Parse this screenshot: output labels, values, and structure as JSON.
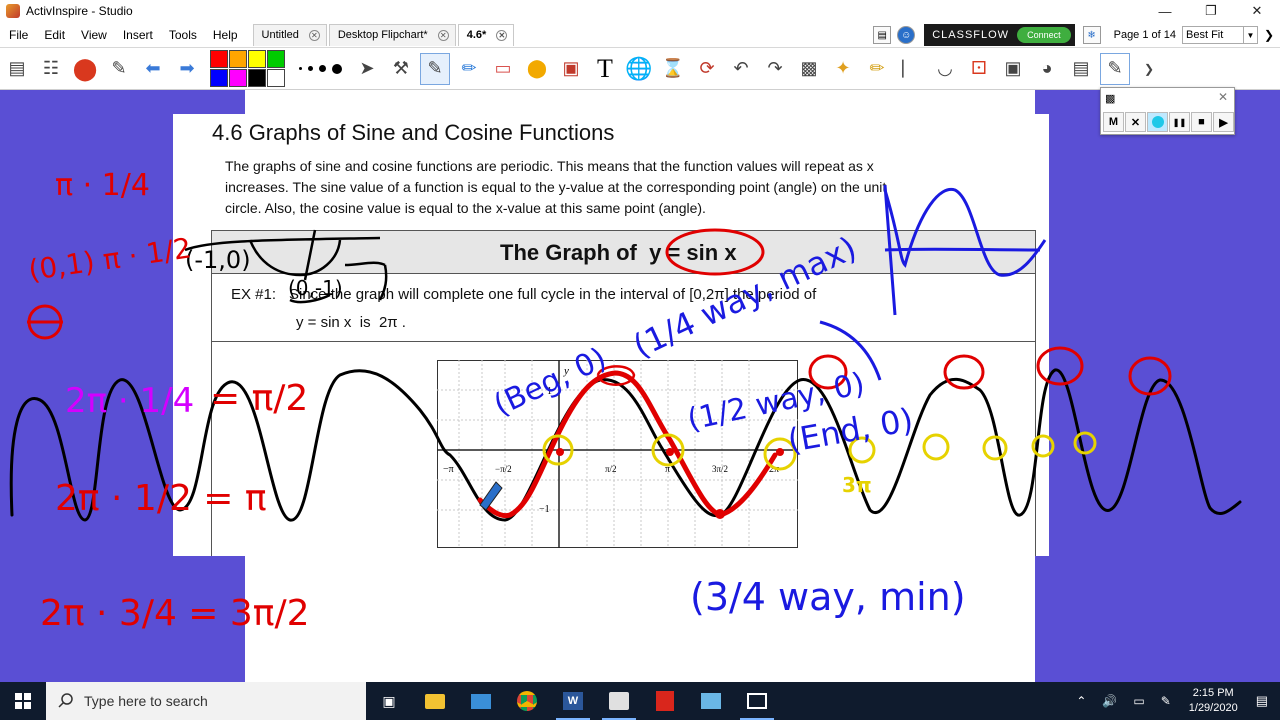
{
  "window": {
    "title": "ActivInspire - Studio"
  },
  "menu": {
    "items": [
      "File",
      "Edit",
      "View",
      "Insert",
      "Tools",
      "Help"
    ]
  },
  "tabs": [
    {
      "label": "Untitled"
    },
    {
      "label": "Desktop Flipchart*"
    },
    {
      "label": "4.6*"
    }
  ],
  "classflow": {
    "brand": "CLASSFLOW",
    "connect": "Connect"
  },
  "page_nav": {
    "page_info": "Page 1 of 14",
    "zoom": "Best Fit"
  },
  "palette": [
    "#ff0000",
    "#ffa500",
    "#ffff00",
    "#00cc00",
    "#0000ff",
    "#ff00ff",
    "#000000",
    "#ffffff"
  ],
  "recorder": {
    "buttons": [
      "M",
      "✕",
      "●",
      "❚❚",
      "■",
      "▶"
    ]
  },
  "worksheet": {
    "title": "4.6 Graphs of Sine and Cosine Functions",
    "intro_line1": "The graphs of sine and cosine functions are periodic.  This means that the function values will repeat as x",
    "intro_line2": "increases. The sine value of a function is equal to the y-value at the corresponding point (angle) on the unit",
    "intro_line3": "circle. Also, the cosine value is equal to the x-value at this same point (angle).",
    "section_heading": "The Graph of  y = sin x",
    "ex_label": "EX #1:",
    "ex_text1": "Since the graph will complete one full cycle in the interval of [0,2π] the period of",
    "ex_text2": "y = sin x  is  2π .",
    "graph": {
      "x_ticks": [
        "−π",
        "−π/2",
        "π/2",
        "π",
        "3π/2",
        "2π"
      ],
      "y_ticks": [
        "1",
        "−1"
      ],
      "y_label": "y"
    }
  },
  "annotations": {
    "red_left": [
      "π · 1/4",
      "(0,1) π · 1/2",
      "2π · 1/2 = π",
      "2π · 3/4 = 3π/2",
      "= π/2"
    ],
    "magenta_left": "2π · 1/4",
    "blue_labels": [
      "(Beg, 0)",
      "(1/4 way, max)",
      "(1/2 way, 0)",
      "(End, 0)",
      "(3/4 way, min)"
    ],
    "black_point": "(-1,0)",
    "black_point2": "(0,-1)",
    "yellow_label": "3π"
  },
  "taskbar": {
    "search_placeholder": "Type here to search",
    "time": "2:15 PM",
    "date": "1/29/2020"
  }
}
